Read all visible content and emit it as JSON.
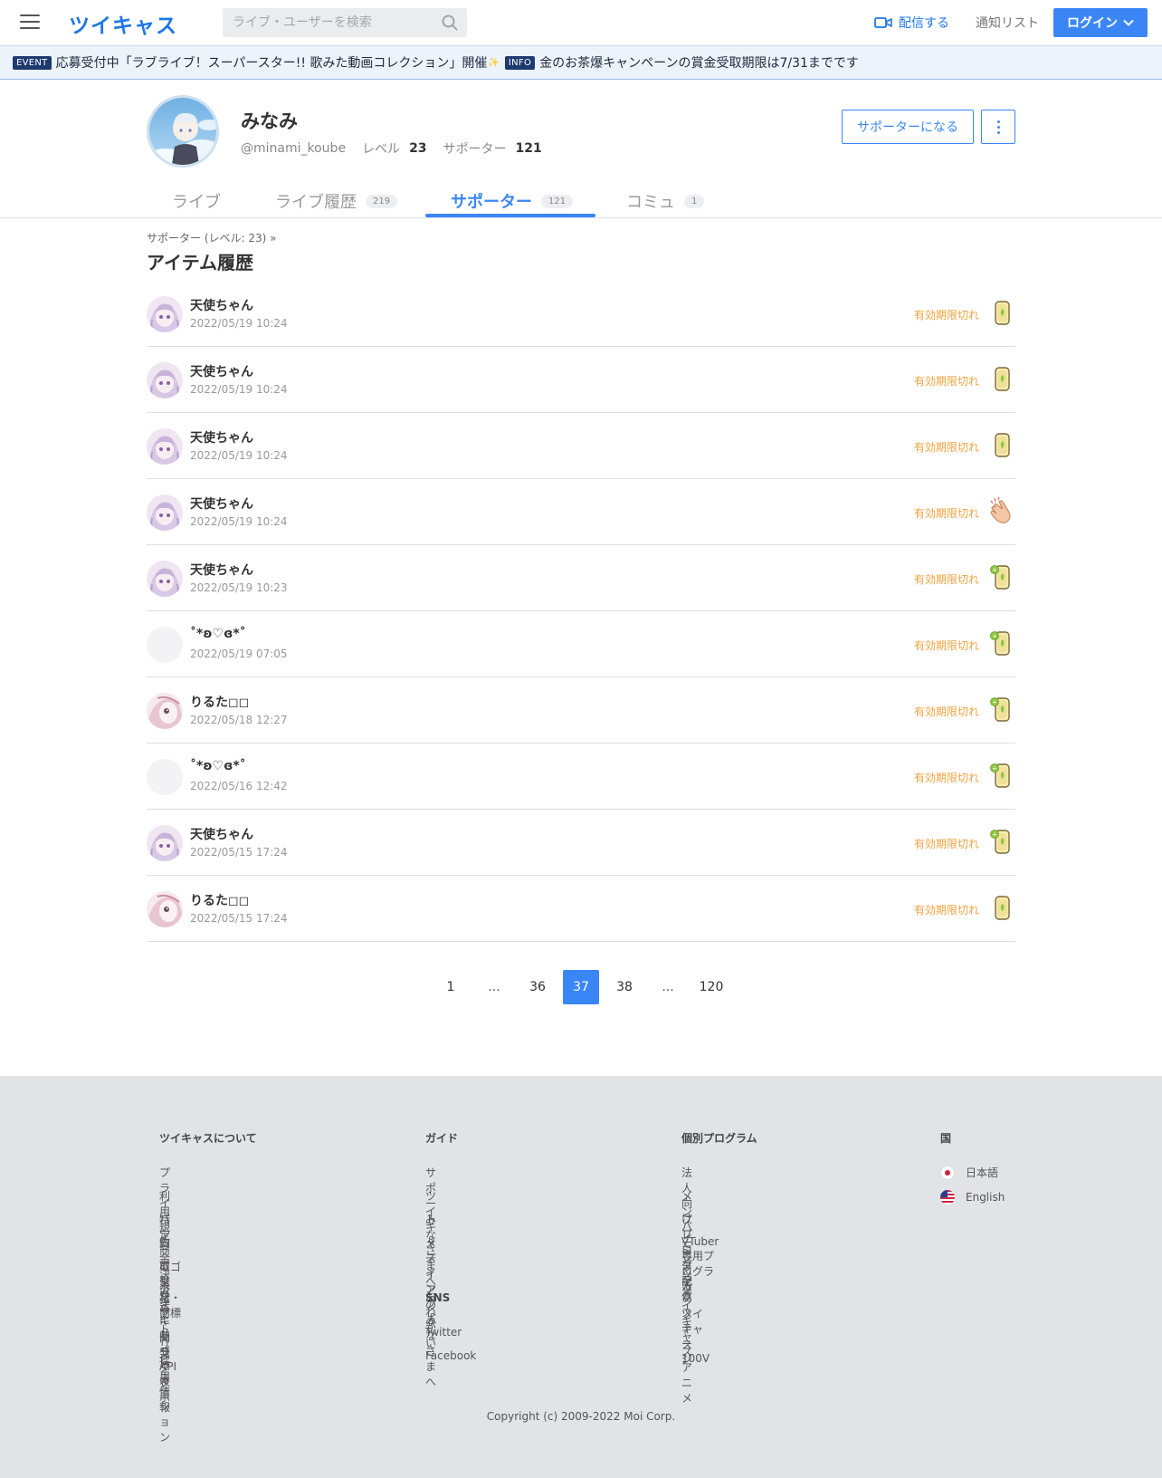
{
  "header": {
    "logo": "ツイキャス",
    "search_placeholder": "ライブ・ユーザーを検索",
    "broadcast_label": "配信する",
    "notification_label": "通知リスト",
    "login_label": "ログイン",
    "accent_color": "#3b86f7"
  },
  "announcements": [
    {
      "badge": "EVENT",
      "text": "応募受付中「ラブライブ！スーパースター!! 歌みた動画コレクション」開催"
    },
    {
      "badge": "INFO",
      "text": "金のお茶爆キャンペーンの賞金受取期限は7/31までです"
    }
  ],
  "profile": {
    "name": "みなみ",
    "handle": "@minami_koube",
    "level_label": "レベル",
    "level": "23",
    "supporter_label": "サポーター",
    "supporter_count": "121",
    "become_supporter_button": "サポーターになる"
  },
  "tabs": [
    {
      "label": "ライブ",
      "count": ""
    },
    {
      "label": "ライブ履歴",
      "count": "219"
    },
    {
      "label": "サポーター",
      "count": "121"
    },
    {
      "label": "コミュ",
      "count": "1"
    }
  ],
  "breadcrumb": "サポーター (レベル: 23)  »",
  "section_title": "アイテム履歴",
  "items": [
    {
      "name": "天使ちゃん",
      "time": "2022/05/19 10:24",
      "status": "有効期限切れ",
      "avatar": "angel",
      "item": "tea"
    },
    {
      "name": "天使ちゃん",
      "time": "2022/05/19 10:24",
      "status": "有効期限切れ",
      "avatar": "angel",
      "item": "tea"
    },
    {
      "name": "天使ちゃん",
      "time": "2022/05/19 10:24",
      "status": "有効期限切れ",
      "avatar": "angel",
      "item": "tea"
    },
    {
      "name": "天使ちゃん",
      "time": "2022/05/19 10:24",
      "status": "有効期限切れ",
      "avatar": "angel",
      "item": "clap"
    },
    {
      "name": "天使ちゃん",
      "time": "2022/05/19 10:23",
      "status": "有効期限切れ",
      "avatar": "angel",
      "item": "tea-plus"
    },
    {
      "name": "˚*ʚ♡ɞ*˚",
      "time": "2022/05/19 07:05",
      "status": "有効期限切れ",
      "avatar": "blank",
      "item": "tea-plus"
    },
    {
      "name": "りるた◻◻",
      "time": "2022/05/18 12:27",
      "status": "有効期限切れ",
      "avatar": "pink",
      "item": "tea-plus"
    },
    {
      "name": "˚*ʚ♡ɞ*˚",
      "time": "2022/05/16 12:42",
      "status": "有効期限切れ",
      "avatar": "blank",
      "item": "tea-plus"
    },
    {
      "name": "天使ちゃん",
      "time": "2022/05/15 17:24",
      "status": "有効期限切れ",
      "avatar": "angel",
      "item": "tea-plus"
    },
    {
      "name": "りるた◻◻",
      "time": "2022/05/15 17:24",
      "status": "有効期限切れ",
      "avatar": "pink",
      "item": "tea"
    }
  ],
  "pagination": {
    "pages": [
      "1",
      "...",
      "36",
      "37",
      "38",
      "...",
      "120"
    ],
    "current": "37"
  },
  "footer": {
    "about": {
      "heading": "ツイキャスについて",
      "links": [
        "プライバシーポリシー",
        "利用規約",
        "特定商取引法",
        "資金決済法に基づく表示",
        "ロゴ素材・商標",
        "公式キャラクター",
        "アトリビューション",
        "開発 API",
        "採用情報"
      ]
    },
    "guide": {
      "heading": "ガイド",
      "links": [
        "サポート",
        "ツイキャスインフォ",
        "みなさまへおねがい",
        "メディアのみなさまへ"
      ]
    },
    "sns": {
      "heading": "SNS",
      "links": [
        "Twitter",
        "Facebook"
      ]
    },
    "programs": {
      "heading": "個別プログラム",
      "links": [
        "法人向けプログラム",
        "メンバーシップ",
        "プレミア配信",
        "VTuber専用プログラム",
        "ライブステージ",
        "ツイキャスアニメ",
        "ツイキャス100V"
      ]
    },
    "country": {
      "heading": "国",
      "languages": [
        "日本語",
        "English"
      ]
    },
    "copyright": "Copyright (c) 2009-2022 Moi Corp."
  }
}
